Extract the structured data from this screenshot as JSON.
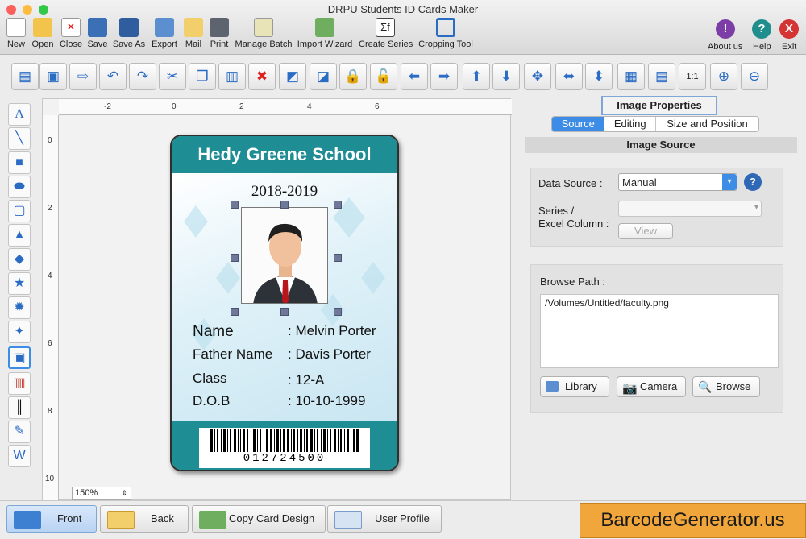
{
  "window": {
    "title": "DRPU Students ID Cards Maker"
  },
  "main_toolbar": {
    "new": "New",
    "open": "Open",
    "close": "Close",
    "save": "Save",
    "save_as": "Save As",
    "export": "Export",
    "mail": "Mail",
    "print": "Print",
    "manage_batch": "Manage Batch",
    "import_wizard": "Import Wizard",
    "create_series": "Create Series",
    "cropping_tool": "Cropping Tool",
    "about_us": "About us",
    "help": "Help",
    "exit": "Exit"
  },
  "canvas": {
    "ruler_top": [
      "-2",
      "0",
      "2",
      "4",
      "6"
    ],
    "ruler_left": [
      "0",
      "2",
      "4",
      "6",
      "8",
      "10"
    ],
    "zoom": "150%"
  },
  "card": {
    "school": "Hedy Greene School",
    "year": "2018-2019",
    "fields": [
      {
        "label": "Name",
        "value": ": Melvin Porter"
      },
      {
        "label": "Father Name",
        "value": ": Davis Porter"
      },
      {
        "label": "Class",
        "value": ": 12-A"
      },
      {
        "label": "D.O.B",
        "value": ": 10-10-1999"
      }
    ],
    "barcode_number": "012724500"
  },
  "properties": {
    "title": "Image Properties",
    "tabs": [
      "Source",
      "Editing",
      "Size and Position"
    ],
    "active_tab": "Source",
    "section": "Image Source",
    "data_source_label": "Data Source :",
    "data_source_value": "Manual",
    "series_label_1": "Series /",
    "series_label_2": "Excel Column :",
    "series_value": "",
    "view_button": "View",
    "browse_path_label": "Browse Path :",
    "browse_path_value": "/Volumes/Untitled/faculty.png",
    "library_button": "Library",
    "camera_button": "Camera",
    "browse_button": "Browse"
  },
  "bottom_bar": {
    "front": "Front",
    "back": "Back",
    "copy_card_design": "Copy Card Design",
    "user_profile": "User Profile",
    "brand": "BarcodeGenerator.us"
  },
  "colors": {
    "accent": "#1f8d94",
    "tab_active": "#3d8ce6",
    "brand": "#f0a63a"
  }
}
